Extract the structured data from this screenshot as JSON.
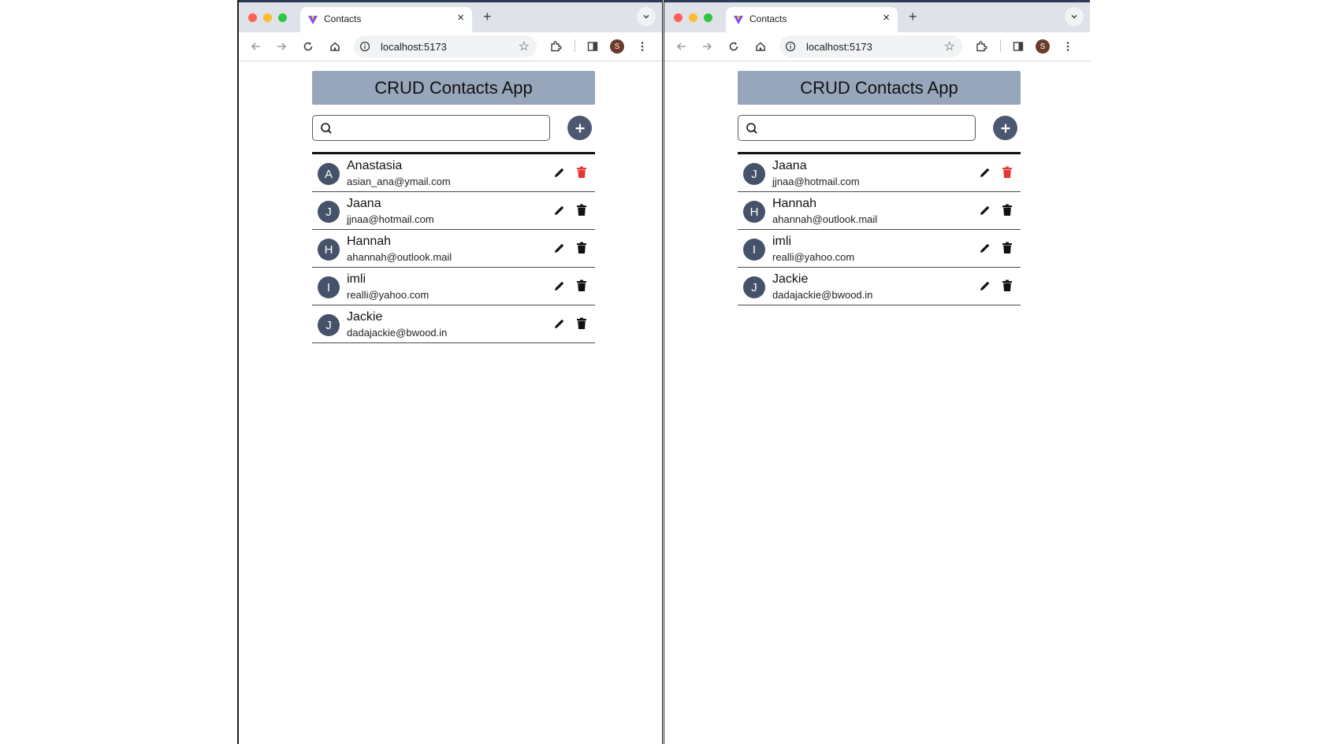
{
  "windows": [
    {
      "browser": {
        "tab_title": "Contacts",
        "url": "localhost:5173",
        "profile_initial": "S"
      },
      "app": {
        "title": "CRUD Contacts App",
        "search": {
          "value": "",
          "placeholder": ""
        },
        "contacts": [
          {
            "initial": "A",
            "name": "Anastasia",
            "email": "asian_ana@ymail.com",
            "delete_color": "#e53935"
          },
          {
            "initial": "J",
            "name": "Jaana",
            "email": "jjnaa@hotmail.com",
            "delete_color": "#111111"
          },
          {
            "initial": "H",
            "name": "Hannah",
            "email": "ahannah@outlook.mail",
            "delete_color": "#111111"
          },
          {
            "initial": "I",
            "name": "imli",
            "email": "realli@yahoo.com",
            "delete_color": "#111111"
          },
          {
            "initial": "J",
            "name": "Jackie",
            "email": "dadajackie@bwood.in",
            "delete_color": "#111111"
          }
        ]
      }
    },
    {
      "browser": {
        "tab_title": "Contacts",
        "url": "localhost:5173",
        "profile_initial": "S"
      },
      "app": {
        "title": "CRUD Contacts App",
        "search": {
          "value": "",
          "placeholder": ""
        },
        "contacts": [
          {
            "initial": "J",
            "name": "Jaana",
            "email": "jjnaa@hotmail.com",
            "delete_color": "#e53935"
          },
          {
            "initial": "H",
            "name": "Hannah",
            "email": "ahannah@outlook.mail",
            "delete_color": "#111111"
          },
          {
            "initial": "I",
            "name": "imli",
            "email": "realli@yahoo.com",
            "delete_color": "#111111"
          },
          {
            "initial": "J",
            "name": "Jackie",
            "email": "dadajackie@bwood.in",
            "delete_color": "#111111"
          }
        ]
      }
    }
  ],
  "colors": {
    "header_bg": "#97a6bb",
    "avatar_bg": "#46526a",
    "add_button_bg": "#4b5870",
    "delete_highlight": "#e53935"
  },
  "icons": {
    "search": "search-icon",
    "add": "plus-icon",
    "edit": "pencil-icon",
    "delete": "trash-icon"
  }
}
